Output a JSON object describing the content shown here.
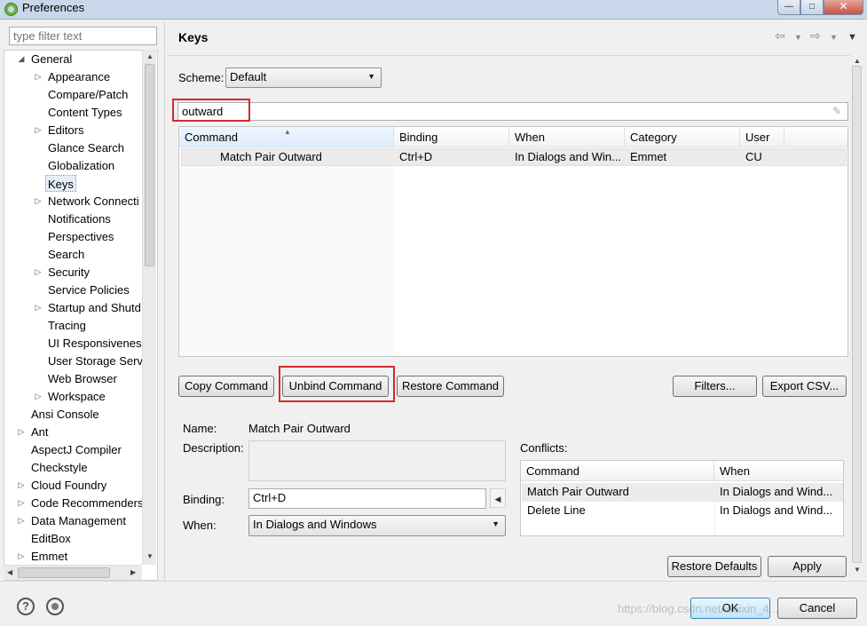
{
  "window": {
    "title": "Preferences"
  },
  "filter": {
    "placeholder": "type filter text"
  },
  "tree": [
    {
      "label": "General",
      "expanded": true,
      "level": 0
    },
    {
      "label": "Appearance",
      "level": 1,
      "arrow": true
    },
    {
      "label": "Compare/Patch",
      "level": 1
    },
    {
      "label": "Content Types",
      "level": 1
    },
    {
      "label": "Editors",
      "level": 1,
      "arrow": true
    },
    {
      "label": "Glance Search",
      "level": 1
    },
    {
      "label": "Globalization",
      "level": 1
    },
    {
      "label": "Keys",
      "level": 1,
      "selected": true
    },
    {
      "label": "Network Connecti",
      "level": 1,
      "arrow": true
    },
    {
      "label": "Notifications",
      "level": 1
    },
    {
      "label": "Perspectives",
      "level": 1
    },
    {
      "label": "Search",
      "level": 1
    },
    {
      "label": "Security",
      "level": 1,
      "arrow": true
    },
    {
      "label": "Service Policies",
      "level": 1
    },
    {
      "label": "Startup and Shutd",
      "level": 1,
      "arrow": true
    },
    {
      "label": "Tracing",
      "level": 1
    },
    {
      "label": "UI Responsiveness",
      "level": 1
    },
    {
      "label": "User Storage Serv",
      "level": 1
    },
    {
      "label": "Web Browser",
      "level": 1
    },
    {
      "label": "Workspace",
      "level": 1,
      "arrow": true
    },
    {
      "label": "Ansi Console",
      "level": 0
    },
    {
      "label": "Ant",
      "level": 0,
      "arrow": true
    },
    {
      "label": "AspectJ Compiler",
      "level": 0
    },
    {
      "label": "Checkstyle",
      "level": 0
    },
    {
      "label": "Cloud Foundry",
      "level": 0,
      "arrow": true
    },
    {
      "label": "Code Recommenders",
      "level": 0,
      "arrow": true
    },
    {
      "label": "Data Management",
      "level": 0,
      "arrow": true
    },
    {
      "label": "EditBox",
      "level": 0
    },
    {
      "label": "Emmet",
      "level": 0,
      "arrow": true
    }
  ],
  "page": {
    "title": "Keys"
  },
  "scheme": {
    "label": "Scheme:",
    "value": "Default"
  },
  "search": {
    "value": "outward"
  },
  "table": {
    "headers": [
      "Command",
      "Binding",
      "When",
      "Category",
      "User"
    ],
    "rows": [
      {
        "command": "Match Pair Outward",
        "binding": "Ctrl+D",
        "when": "In Dialogs and Win...",
        "category": "Emmet",
        "user": "CU"
      }
    ]
  },
  "buttons": {
    "copy": "Copy Command",
    "unbind": "Unbind Command",
    "restore": "Restore Command",
    "filters": "Filters...",
    "export": "Export CSV...",
    "restore_defaults": "Restore Defaults",
    "apply": "Apply",
    "ok": "OK",
    "cancel": "Cancel"
  },
  "details": {
    "name_label": "Name:",
    "name_value": "Match Pair Outward",
    "description_label": "Description:",
    "binding_label": "Binding:",
    "binding_value": "Ctrl+D",
    "when_label": "When:",
    "when_value": "In Dialogs and Windows"
  },
  "conflicts": {
    "label": "Conflicts:",
    "headers": [
      "Command",
      "When"
    ],
    "rows": [
      {
        "command": "Match Pair Outward",
        "when": "In Dialogs and Wind..."
      },
      {
        "command": "Delete Line",
        "when": "In Dialogs and Wind..."
      }
    ]
  },
  "watermark": "https://blog.csdn.net/weixin_4..."
}
